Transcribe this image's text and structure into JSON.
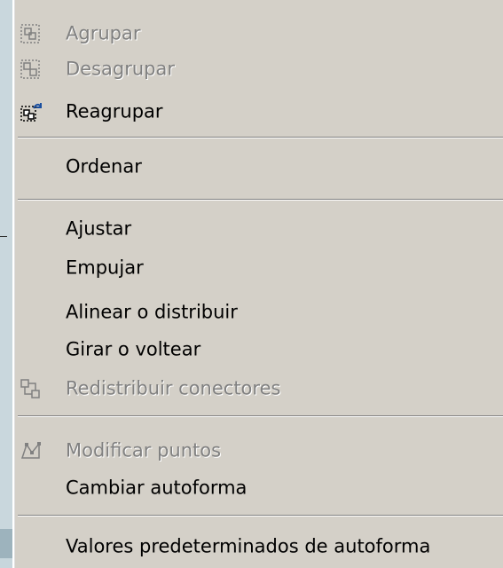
{
  "menu": {
    "items": [
      {
        "label": "Agrupar",
        "enabled": false,
        "icon": "group-icon",
        "submenu": false
      },
      {
        "label": "Desagrupar",
        "enabled": false,
        "icon": "ungroup-icon",
        "submenu": false
      },
      {
        "label": "Reagrupar",
        "enabled": true,
        "icon": "regroup-icon",
        "submenu": false
      },
      {
        "label": "Ordenar",
        "enabled": true,
        "icon": "",
        "submenu": true
      },
      {
        "label": "Ajustar",
        "enabled": true,
        "icon": "",
        "submenu": true
      },
      {
        "label": "Empujar",
        "enabled": true,
        "icon": "",
        "submenu": true
      },
      {
        "label": "Alinear o distribuir",
        "enabled": true,
        "icon": "",
        "submenu": true
      },
      {
        "label": "Girar o voltear",
        "enabled": true,
        "icon": "",
        "submenu": true
      },
      {
        "label": "Redistribuir conectores",
        "enabled": false,
        "icon": "reroute-connectors-icon",
        "submenu": false
      },
      {
        "label": "Modificar puntos",
        "enabled": false,
        "icon": "edit-points-icon",
        "submenu": false
      },
      {
        "label": "Cambiar autoforma",
        "enabled": true,
        "icon": "",
        "submenu": true
      },
      {
        "label": "Valores predeterminados de autoforma",
        "enabled": true,
        "icon": "",
        "submenu": false
      }
    ]
  }
}
